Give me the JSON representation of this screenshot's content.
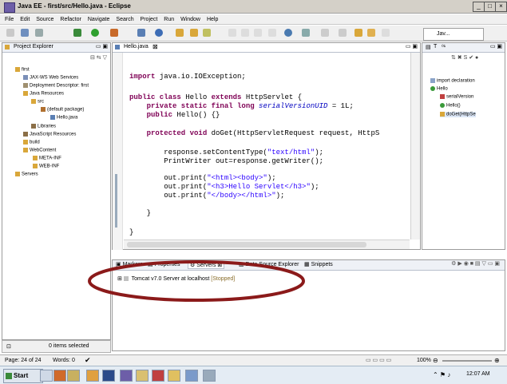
{
  "window": {
    "title": "Java EE - first/src/Hello.java - Eclipse"
  },
  "menu": [
    "File",
    "Edit",
    "Source",
    "Refactor",
    "Navigate",
    "Search",
    "Project",
    "Run",
    "Window",
    "Help"
  ],
  "perspective": {
    "label": "Jav..."
  },
  "project_explorer": {
    "title": "Project Explorer",
    "items": [
      "first",
      "JAX-WS Web Services",
      "Deployment Descriptor: first",
      "Java Resources",
      "src",
      "(default package)",
      "Hello.java",
      "Libraries",
      "JavaScript Resources",
      "build",
      "WebContent",
      "META-INF",
      "WEB-INF",
      "Servers"
    ]
  },
  "editor": {
    "tab": "Hello.java",
    "lines": {
      "l1a": "import",
      "l1b": " java.io.IOException;",
      "l2a": "public class",
      "l2b": " Hello ",
      "l2c": "extends",
      "l2d": " HttpServlet {",
      "l3a": "    private static final long",
      "l3b": " serialVersionUID",
      "l3c": " = 1L;",
      "l4a": "    public",
      "l4b": " Hello() {}",
      "l5a": "    protected void",
      "l5b": " doGet(HttpServletRequest request, HttpS",
      "l6a": "        response.setContentType(",
      "l6b": "\"text/html\"",
      "l6c": ");",
      "l7": "        PrintWriter out=response.getWriter();",
      "l8a": "        out.print(",
      "l8b": "\"<html><body>\"",
      "l8c": ");",
      "l9a": "        out.print(",
      "l9b": "\"<h3>Hello Servlet</h3>\"",
      "l9c": ");",
      "l10a": "        out.print(",
      "l10b": "\"</body></html>\"",
      "l10c": ");",
      "l11": "    }",
      "l12": "}"
    }
  },
  "outline": {
    "tab1": "T",
    "items": [
      "import declaration",
      "Hello",
      "serialVersion",
      "Hello()",
      "doGet(HttpSe"
    ]
  },
  "bottom_panel": {
    "tabs": [
      "Markers",
      "Properties",
      "Servers",
      "Data Source Explorer",
      "Snippets"
    ],
    "server": "Tomcat v7.0 Server at localhost",
    "server_state": "[Stopped]"
  },
  "statusbar": {
    "explorer_status": "0 items selected",
    "page": "Page: 24 of 24",
    "words": "Words: 0",
    "zoom": "100%"
  },
  "taskbar": {
    "start": "Start",
    "clock": "12:07 AM"
  },
  "colors": {
    "annotation_ellipse": "#8b1a1a",
    "keyword": "#7f0055",
    "string": "#2a00ff"
  }
}
